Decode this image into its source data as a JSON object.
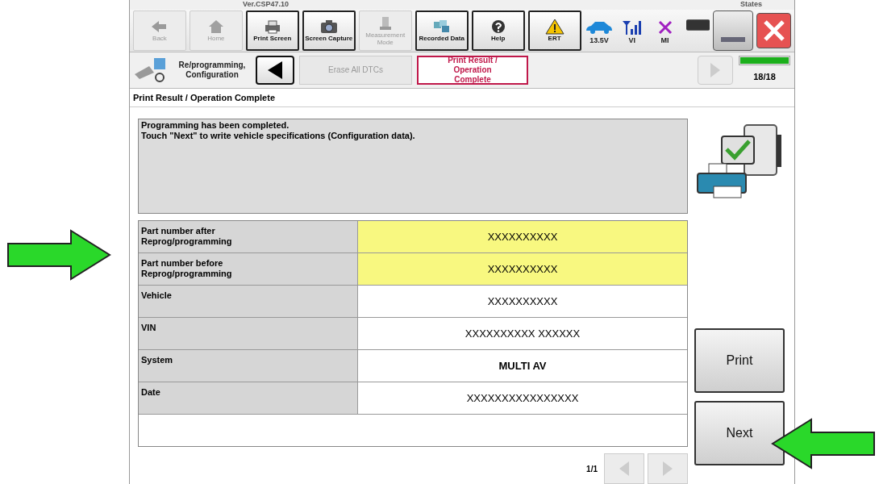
{
  "header": {
    "version": "Ver.CSP47.10",
    "states_label": "States"
  },
  "toolbar": [
    {
      "label": "Back",
      "kind": "back",
      "disabled": true
    },
    {
      "label": "Home",
      "kind": "home",
      "disabled": true
    },
    {
      "label": "Print Screen",
      "kind": "printer",
      "disabled": false
    },
    {
      "label": "Screen Capture",
      "kind": "camera",
      "disabled": false
    },
    {
      "label": "Measurement Mode",
      "kind": "meter",
      "disabled": true
    },
    {
      "label": "Recorded Data",
      "kind": "data",
      "disabled": false
    },
    {
      "label": "Help",
      "kind": "help",
      "disabled": false
    },
    {
      "label": "ERT",
      "kind": "warning",
      "disabled": false
    }
  ],
  "status": [
    {
      "label": "13.5V",
      "kind": "car"
    },
    {
      "label": "VI",
      "kind": "signal"
    },
    {
      "label": "MI",
      "kind": "cross"
    }
  ],
  "steps": {
    "section": "Re/programming, Configuration",
    "items": [
      {
        "label": "Erase All DTCs",
        "selected": false
      },
      {
        "label": "Print Result / Operation Complete",
        "selected": true
      }
    ],
    "progress": {
      "level": 1.0,
      "text": "18/18"
    }
  },
  "page_title": "Print Result / Operation Complete",
  "message": [
    "Programming has been completed.",
    "Touch \"Next\" to write vehicle specifications (Configuration data)."
  ],
  "table": [
    {
      "label": "Part number after Reprog/programming",
      "value": "XXXXXXXXXX",
      "highlighted": true,
      "bold": false
    },
    {
      "label": "Part number before Reprog/programming",
      "value": "XXXXXXXXXX",
      "highlighted": true,
      "bold": false
    },
    {
      "label": "Vehicle",
      "value": "XXXXXXXXXX",
      "highlighted": false,
      "bold": false
    },
    {
      "label": "VIN",
      "value": "XXXXXXXXXX XXXXXX",
      "highlighted": false,
      "bold": false
    },
    {
      "label": "System",
      "value": "MULTI AV",
      "highlighted": false,
      "bold": true
    },
    {
      "label": "Date",
      "value": "XXXXXXXXXXXXXXXX",
      "highlighted": false,
      "bold": false
    }
  ],
  "pagination": "1/1",
  "buttons": [
    "Print",
    "Next"
  ]
}
